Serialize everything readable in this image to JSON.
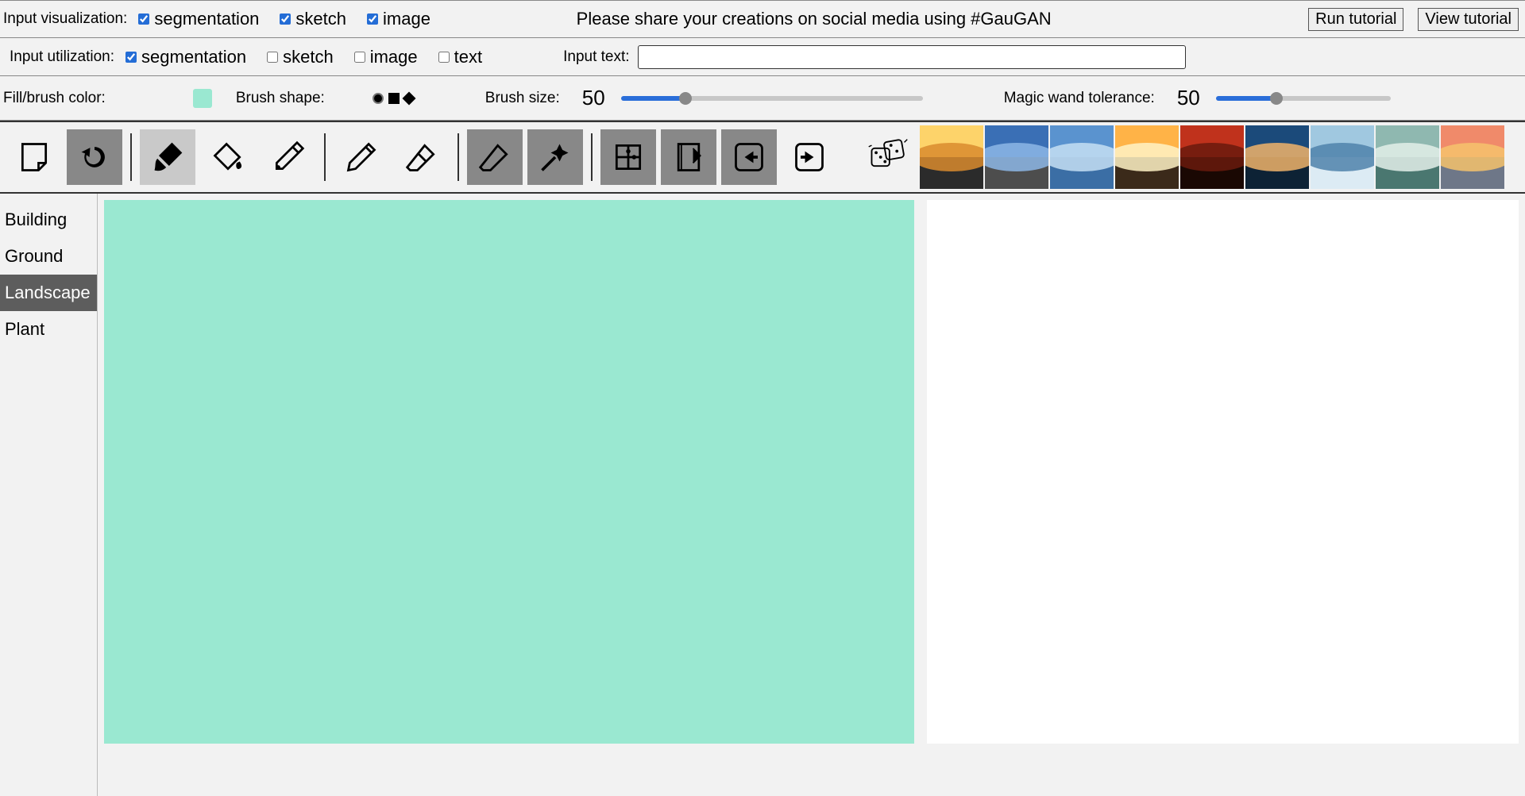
{
  "header": {
    "visualization_label": "Input visualization:",
    "utilization_label": "Input utilization:",
    "share_msg": "Please share your creations on social media using #GauGAN",
    "run_tutorial": "Run tutorial",
    "view_tutorial": "View tutorial",
    "input_text_label": "Input text:",
    "input_text_value": ""
  },
  "vis_opts": {
    "segmentation": {
      "label": "segmentation",
      "checked": true
    },
    "sketch": {
      "label": "sketch",
      "checked": true
    },
    "image": {
      "label": "image",
      "checked": true
    }
  },
  "util_opts": {
    "segmentation": {
      "label": "segmentation",
      "checked": true
    },
    "sketch": {
      "label": "sketch",
      "checked": false
    },
    "image": {
      "label": "image",
      "checked": false
    },
    "text": {
      "label": "text",
      "checked": false
    }
  },
  "brush_bar": {
    "fill_label": "Fill/brush color:",
    "fill_color": "#9ae8d1",
    "shape_label": "Brush shape:",
    "size_label": "Brush size:",
    "size_value": "50",
    "tolerance_label": "Magic wand tolerance:",
    "tolerance_value": "50"
  },
  "tools": {
    "note": "note-tool",
    "undo": "undo-tool",
    "brush": "brush-tool",
    "fill": "fill-tool",
    "eyedropper": "eyedropper-tool",
    "pencil": "pencil-tool",
    "eraser": "eraser-tool",
    "smart_eraser": "smart-eraser-tool",
    "magic_wand": "magic-wand-tool",
    "puzzle": "puzzle-tool",
    "notebook": "notebook-tool",
    "import": "import-tool",
    "export": "export-tool",
    "random": "random-dice"
  },
  "style_thumbs": [
    {
      "name": "style-thumb-1",
      "colors": [
        "#fdd36a",
        "#d98b2e",
        "#2b2b2b"
      ]
    },
    {
      "name": "style-thumb-2",
      "colors": [
        "#3a6fb5",
        "#8db7e6",
        "#4d4d4d"
      ]
    },
    {
      "name": "style-thumb-3",
      "colors": [
        "#5a93cf",
        "#c6dff3",
        "#3b6ea5"
      ]
    },
    {
      "name": "style-thumb-4",
      "colors": [
        "#ffb347",
        "#fff2c6",
        "#3b2a1a"
      ]
    },
    {
      "name": "style-thumb-5",
      "colors": [
        "#c0321c",
        "#6a1a0d",
        "#1a0803"
      ]
    },
    {
      "name": "style-thumb-6",
      "colors": [
        "#1b4a7a",
        "#f0b36a",
        "#0d2235"
      ]
    },
    {
      "name": "style-thumb-7",
      "colors": [
        "#a0c8e0",
        "#4f82aa",
        "#dcebf4"
      ]
    },
    {
      "name": "style-thumb-8",
      "colors": [
        "#8fb8b0",
        "#e3efe9",
        "#4a7770"
      ]
    },
    {
      "name": "style-thumb-9",
      "colors": [
        "#f08a6a",
        "#f6c26c",
        "#6e7788"
      ]
    }
  ],
  "sidebar": {
    "items": [
      {
        "label": "Building",
        "active": false
      },
      {
        "label": "Ground",
        "active": false
      },
      {
        "label": "Landscape",
        "active": true
      },
      {
        "label": "Plant",
        "active": false
      }
    ]
  },
  "canvas": {
    "fill": "#9ae8d1"
  }
}
